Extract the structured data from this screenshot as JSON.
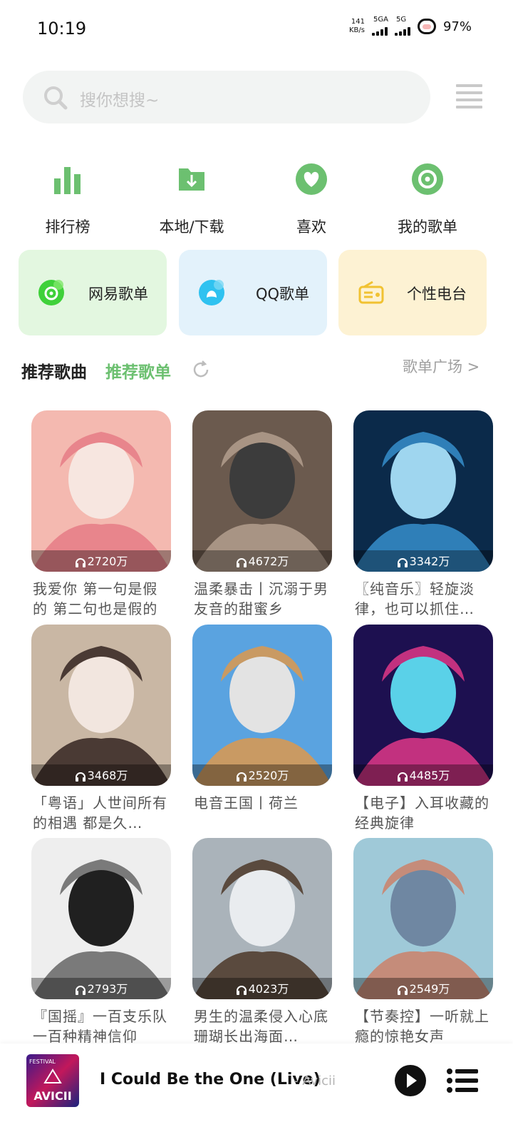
{
  "status_bar": {
    "time": "10:19",
    "net_speed_value": "141",
    "net_speed_unit": "KB/s",
    "signal1": "5GA",
    "signal2": "5G",
    "battery": "97%"
  },
  "search": {
    "placeholder": "搜你想搜~"
  },
  "quick_nav": [
    {
      "label": "排行榜",
      "icon": "chart-bars-icon"
    },
    {
      "label": "本地/下载",
      "icon": "download-folder-icon"
    },
    {
      "label": "喜欢",
      "icon": "heart-icon"
    },
    {
      "label": "我的歌单",
      "icon": "disc-icon"
    }
  ],
  "sources": [
    {
      "label": "网易歌单",
      "icon": "netease-music-icon"
    },
    {
      "label": "QQ歌单",
      "icon": "qq-music-icon"
    },
    {
      "label": "个性电台",
      "icon": "radio-icon"
    }
  ],
  "tabs": {
    "songs": "推荐歌曲",
    "playlists": "推荐歌单",
    "plaza": "歌单广场 >"
  },
  "playlists": [
    {
      "plays": "2720万",
      "title": "我爱你 第一句是假的 第二句也是假的"
    },
    {
      "plays": "4672万",
      "title": "温柔暴击丨沉溺于男友音的甜蜜乡"
    },
    {
      "plays": "3342万",
      "title": "〖纯音乐〗轻旋淡律，也可以抓住…"
    },
    {
      "plays": "3468万",
      "title": "「粤语」人世间所有的相遇 都是久…"
    },
    {
      "plays": "2520万",
      "title": "电音王国丨荷兰"
    },
    {
      "plays": "4485万",
      "title": "【电子】入耳收藏的经典旋律"
    },
    {
      "plays": "2793万",
      "title": "『国摇』一百支乐队一百种精神信仰"
    },
    {
      "plays": "4023万",
      "title": "男生的温柔侵入心底 珊瑚长出海面…"
    },
    {
      "plays": "2549万",
      "title": "【节奏控】一听就上瘾的惊艳女声"
    }
  ],
  "player": {
    "title": "I Could Be the One (Live)",
    "artist": "- Avicii",
    "album_text": "AVICII",
    "album_small": "FESTIVAL"
  },
  "colors": {
    "accent_green": "#6cc070",
    "card_green": "#e3f7e0",
    "card_blue": "#e3f2fb",
    "card_yellow": "#fdf2d3"
  }
}
